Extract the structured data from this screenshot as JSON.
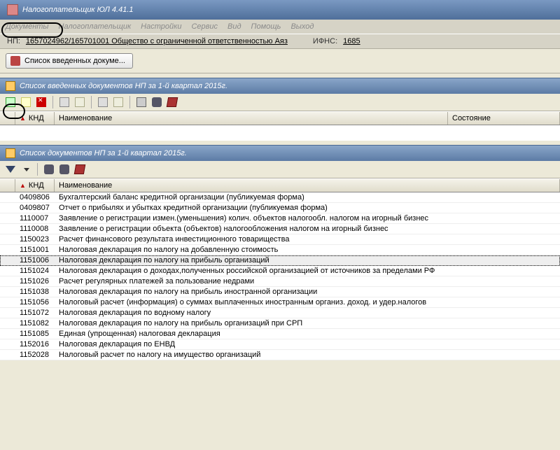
{
  "app": {
    "title": "Налогоплательщик ЮЛ 4.41.1"
  },
  "menu": {
    "documents": "Документы",
    "taxpayer": "Налогоплательщик",
    "settings": "Настройки",
    "service": "Сервис",
    "view": "Вид",
    "help": "Помощь",
    "exit": "Выход"
  },
  "info": {
    "np_label": "НП:",
    "np_value": "1657024962/165701001 Общество с ограниченной ответственностью Аяз",
    "ifns_label": "ИФНС:",
    "ifns_value": "1685"
  },
  "button_bar": {
    "list_entered": "Список введенных докуме..."
  },
  "panel1": {
    "title": "Список введенных документов НП за 1-й квартал 2015г.",
    "columns": {
      "knd": "КНД",
      "name": "Наименование",
      "state": "Состояние"
    }
  },
  "panel2": {
    "title": "Список документов НП за 1-й квартал 2015г.",
    "columns": {
      "knd": "КНД",
      "name": "Наименование"
    },
    "selected_knd": "1151006",
    "rows": [
      {
        "knd": "0409806",
        "name": "Бухгалтерский баланс кредитной организации  (публикуемая форма)"
      },
      {
        "knd": "0409807",
        "name": "Отчет о прибылях и убытках кредитной организации  (публикуемая форма)"
      },
      {
        "knd": "1110007",
        "name": "Заявление о регистрации измен.(уменьшения) колич. объектов  налогообл. налогом на игорный бизнес"
      },
      {
        "knd": "1110008",
        "name": "Заявление о регистрации объекта (объектов) налогообложения налогом на игорный бизнес"
      },
      {
        "knd": "1150023",
        "name": "Расчет финансового результата инвестиционного товарищества"
      },
      {
        "knd": "1151001",
        "name": "Налоговая декларация по налогу на добавленную стоимость"
      },
      {
        "knd": "1151006",
        "name": "Налоговая декларация по налогу на прибыль организаций"
      },
      {
        "knd": "1151024",
        "name": "Налоговая декларация о доходах,полученных российской организацией от источников за пределами РФ"
      },
      {
        "knd": "1151026",
        "name": "Расчет регулярных платежей за пользование недрами"
      },
      {
        "knd": "1151038",
        "name": "Налоговая декларация по налогу на прибыль иностранной организации"
      },
      {
        "knd": "1151056",
        "name": "Налоговый расчет (информация) о суммах выплаченных иностранным организ. доход. и удер.налогов"
      },
      {
        "knd": "1151072",
        "name": "Налоговая декларация по водному налогу"
      },
      {
        "knd": "1151082",
        "name": "Налоговая декларация по налогу на прибыль организаций при СРП"
      },
      {
        "knd": "1151085",
        "name": "Единая (упрощенная) налоговая декларация"
      },
      {
        "knd": "1152016",
        "name": "Налоговая декларация по ЕНВД"
      },
      {
        "knd": "1152028",
        "name": "Налоговый расчет по налогу на имущество организаций"
      }
    ]
  }
}
